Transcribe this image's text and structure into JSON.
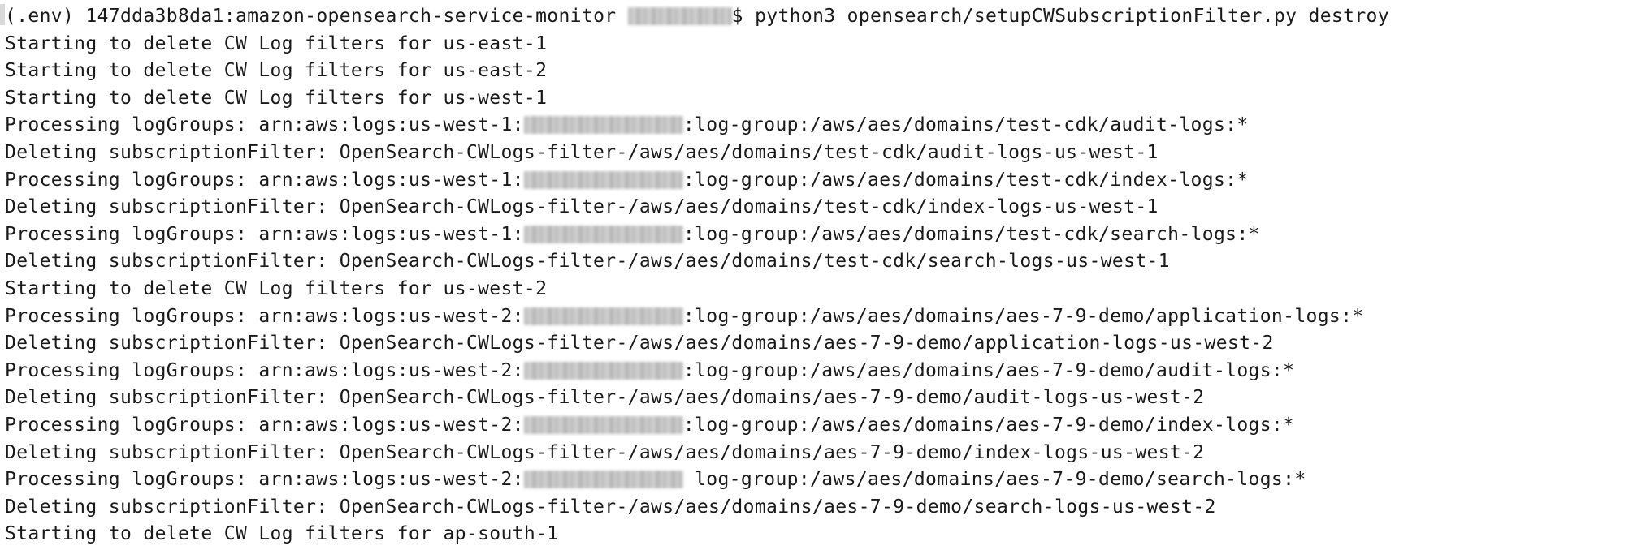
{
  "terminal": {
    "prompt": {
      "env": "(.env)",
      "host": "147dda3b8da1:amazon-opensearch-service-monitor",
      "symbol": "$",
      "command": "python3 opensearch/setupCWSubscriptionFilter.py destroy"
    },
    "lines": [
      {
        "kind": "text",
        "text": "Starting to delete CW Log filters for us-east-1"
      },
      {
        "kind": "text",
        "text": "Starting to delete CW Log filters for us-east-2"
      },
      {
        "kind": "text",
        "text": "Starting to delete CW Log filters for us-west-1"
      },
      {
        "kind": "arn",
        "prefix": "Processing logGroups: arn:aws:logs:us-west-1:",
        "suffix": ":log-group:/aws/aes/domains/test-cdk/audit-logs:*"
      },
      {
        "kind": "text",
        "text": "Deleting subscriptionFilter: OpenSearch-CWLogs-filter-/aws/aes/domains/test-cdk/audit-logs-us-west-1"
      },
      {
        "kind": "arn",
        "prefix": "Processing logGroups: arn:aws:logs:us-west-1:",
        "suffix": ":log-group:/aws/aes/domains/test-cdk/index-logs:*"
      },
      {
        "kind": "text",
        "text": "Deleting subscriptionFilter: OpenSearch-CWLogs-filter-/aws/aes/domains/test-cdk/index-logs-us-west-1"
      },
      {
        "kind": "arn",
        "prefix": "Processing logGroups: arn:aws:logs:us-west-1:",
        "suffix": ":log-group:/aws/aes/domains/test-cdk/search-logs:*"
      },
      {
        "kind": "text",
        "text": "Deleting subscriptionFilter: OpenSearch-CWLogs-filter-/aws/aes/domains/test-cdk/search-logs-us-west-1"
      },
      {
        "kind": "text",
        "text": "Starting to delete CW Log filters for us-west-2"
      },
      {
        "kind": "arn",
        "prefix": "Processing logGroups: arn:aws:logs:us-west-2:",
        "suffix": ":log-group:/aws/aes/domains/aes-7-9-demo/application-logs:*"
      },
      {
        "kind": "text",
        "text": "Deleting subscriptionFilter: OpenSearch-CWLogs-filter-/aws/aes/domains/aes-7-9-demo/application-logs-us-west-2"
      },
      {
        "kind": "arn",
        "prefix": "Processing logGroups: arn:aws:logs:us-west-2:",
        "suffix": ":log-group:/aws/aes/domains/aes-7-9-demo/audit-logs:*"
      },
      {
        "kind": "text",
        "text": "Deleting subscriptionFilter: OpenSearch-CWLogs-filter-/aws/aes/domains/aes-7-9-demo/audit-logs-us-west-2"
      },
      {
        "kind": "arn",
        "prefix": "Processing logGroups: arn:aws:logs:us-west-2:",
        "suffix": ":log-group:/aws/aes/domains/aes-7-9-demo/index-logs:*"
      },
      {
        "kind": "text",
        "text": "Deleting subscriptionFilter: OpenSearch-CWLogs-filter-/aws/aes/domains/aes-7-9-demo/index-logs-us-west-2"
      },
      {
        "kind": "arn",
        "prefix": "Processing logGroups: arn:aws:logs:us-west-2:",
        "suffix": " log-group:/aws/aes/domains/aes-7-9-demo/search-logs:*"
      },
      {
        "kind": "text",
        "text": "Deleting subscriptionFilter: OpenSearch-CWLogs-filter-/aws/aes/domains/aes-7-9-demo/search-logs-us-west-2"
      },
      {
        "kind": "text",
        "text": "Starting to delete CW Log filters for ap-south-1"
      }
    ],
    "colors": {
      "background": "#ffffff",
      "text": "#1a1a1a"
    }
  }
}
